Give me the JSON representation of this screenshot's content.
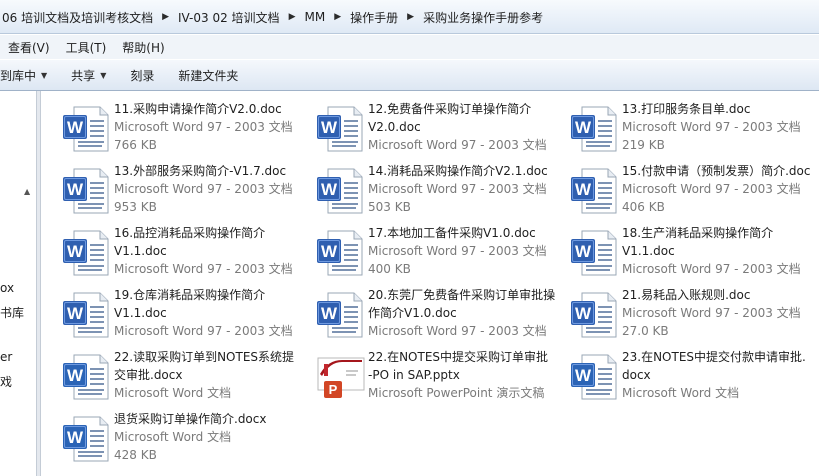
{
  "breadcrumb": [
    "06 培训文档及培训考核文档",
    "IV-03 02 培训文档",
    "MM",
    "操作手册",
    "采购业务操作手册参考"
  ],
  "menu": [
    "查看(V)",
    "工具(T)",
    "帮助(H)"
  ],
  "commands": [
    {
      "label": "到库中",
      "dropdown": true
    },
    {
      "label": "共享",
      "dropdown": true
    },
    {
      "label": "刻录",
      "dropdown": false
    },
    {
      "label": "新建文件夹",
      "dropdown": false
    }
  ],
  "nav_fragments": [
    "ox",
    "书库",
    "er",
    "戏"
  ],
  "files": [
    {
      "icon": "word",
      "name": [
        "11.采购申请操作简介V2.0.doc"
      ],
      "type": "Microsoft Word 97 - 2003 文档",
      "size": "766 KB"
    },
    {
      "icon": "word",
      "name": [
        "12.免费备件采购订单操作简介",
        "V2.0.doc"
      ],
      "type": "Microsoft Word 97 - 2003 文档",
      "size": ""
    },
    {
      "icon": "word",
      "name": [
        "13.打印服务条目单.doc"
      ],
      "type": "Microsoft Word 97 - 2003 文档",
      "size": "219 KB"
    },
    {
      "icon": "word",
      "name": [
        "13.外部服务采购简介-V1.7.doc"
      ],
      "type": "Microsoft Word 97 - 2003 文档",
      "size": "953 KB"
    },
    {
      "icon": "word",
      "name": [
        "14.消耗品采购操作简介V2.1.doc"
      ],
      "type": "Microsoft Word 97 - 2003 文档",
      "size": "503 KB"
    },
    {
      "icon": "word",
      "name": [
        "15.付款申请（预制发票）简介.doc"
      ],
      "type": "Microsoft Word 97 - 2003 文档",
      "size": "406 KB"
    },
    {
      "icon": "word",
      "name": [
        "16.品控消耗品采购操作简介",
        "V1.1.doc"
      ],
      "type": "Microsoft Word 97 - 2003 文档",
      "size": ""
    },
    {
      "icon": "word",
      "name": [
        "17.本地加工备件采购V1.0.doc"
      ],
      "type": "Microsoft Word 97 - 2003 文档",
      "size": "400 KB"
    },
    {
      "icon": "word",
      "name": [
        "18.生产消耗品采购操作简介",
        "V1.1.doc"
      ],
      "type": "Microsoft Word 97 - 2003 文档",
      "size": ""
    },
    {
      "icon": "word",
      "name": [
        "19.仓库消耗品采购操作简介",
        "V1.1.doc"
      ],
      "type": "Microsoft Word 97 - 2003 文档",
      "size": ""
    },
    {
      "icon": "word",
      "name": [
        "20.东莞厂免费备件采购订单审批操",
        "作简介V1.0.doc"
      ],
      "type": "Microsoft Word 97 - 2003 文档",
      "size": ""
    },
    {
      "icon": "word",
      "name": [
        "21.易耗品入账规则.doc"
      ],
      "type": "Microsoft Word 97 - 2003 文档",
      "size": "27.0 KB"
    },
    {
      "icon": "wordx",
      "name": [
        "22.读取采购订单到NOTES系统提",
        "交审批.docx"
      ],
      "type": "Microsoft Word 文档",
      "size": ""
    },
    {
      "icon": "ppt",
      "name": [
        "22.在NOTES中提交采购订单审批",
        "-PO in SAP.pptx"
      ],
      "type": "Microsoft PowerPoint 演示文稿",
      "size": ""
    },
    {
      "icon": "wordx",
      "name": [
        "23.在NOTES中提交付款申请审批.",
        "docx"
      ],
      "type": "Microsoft Word 文档",
      "size": ""
    },
    {
      "icon": "wordx",
      "name": [
        "退货采购订单操作简介.docx"
      ],
      "type": "Microsoft Word 文档",
      "size": "428 KB"
    }
  ]
}
